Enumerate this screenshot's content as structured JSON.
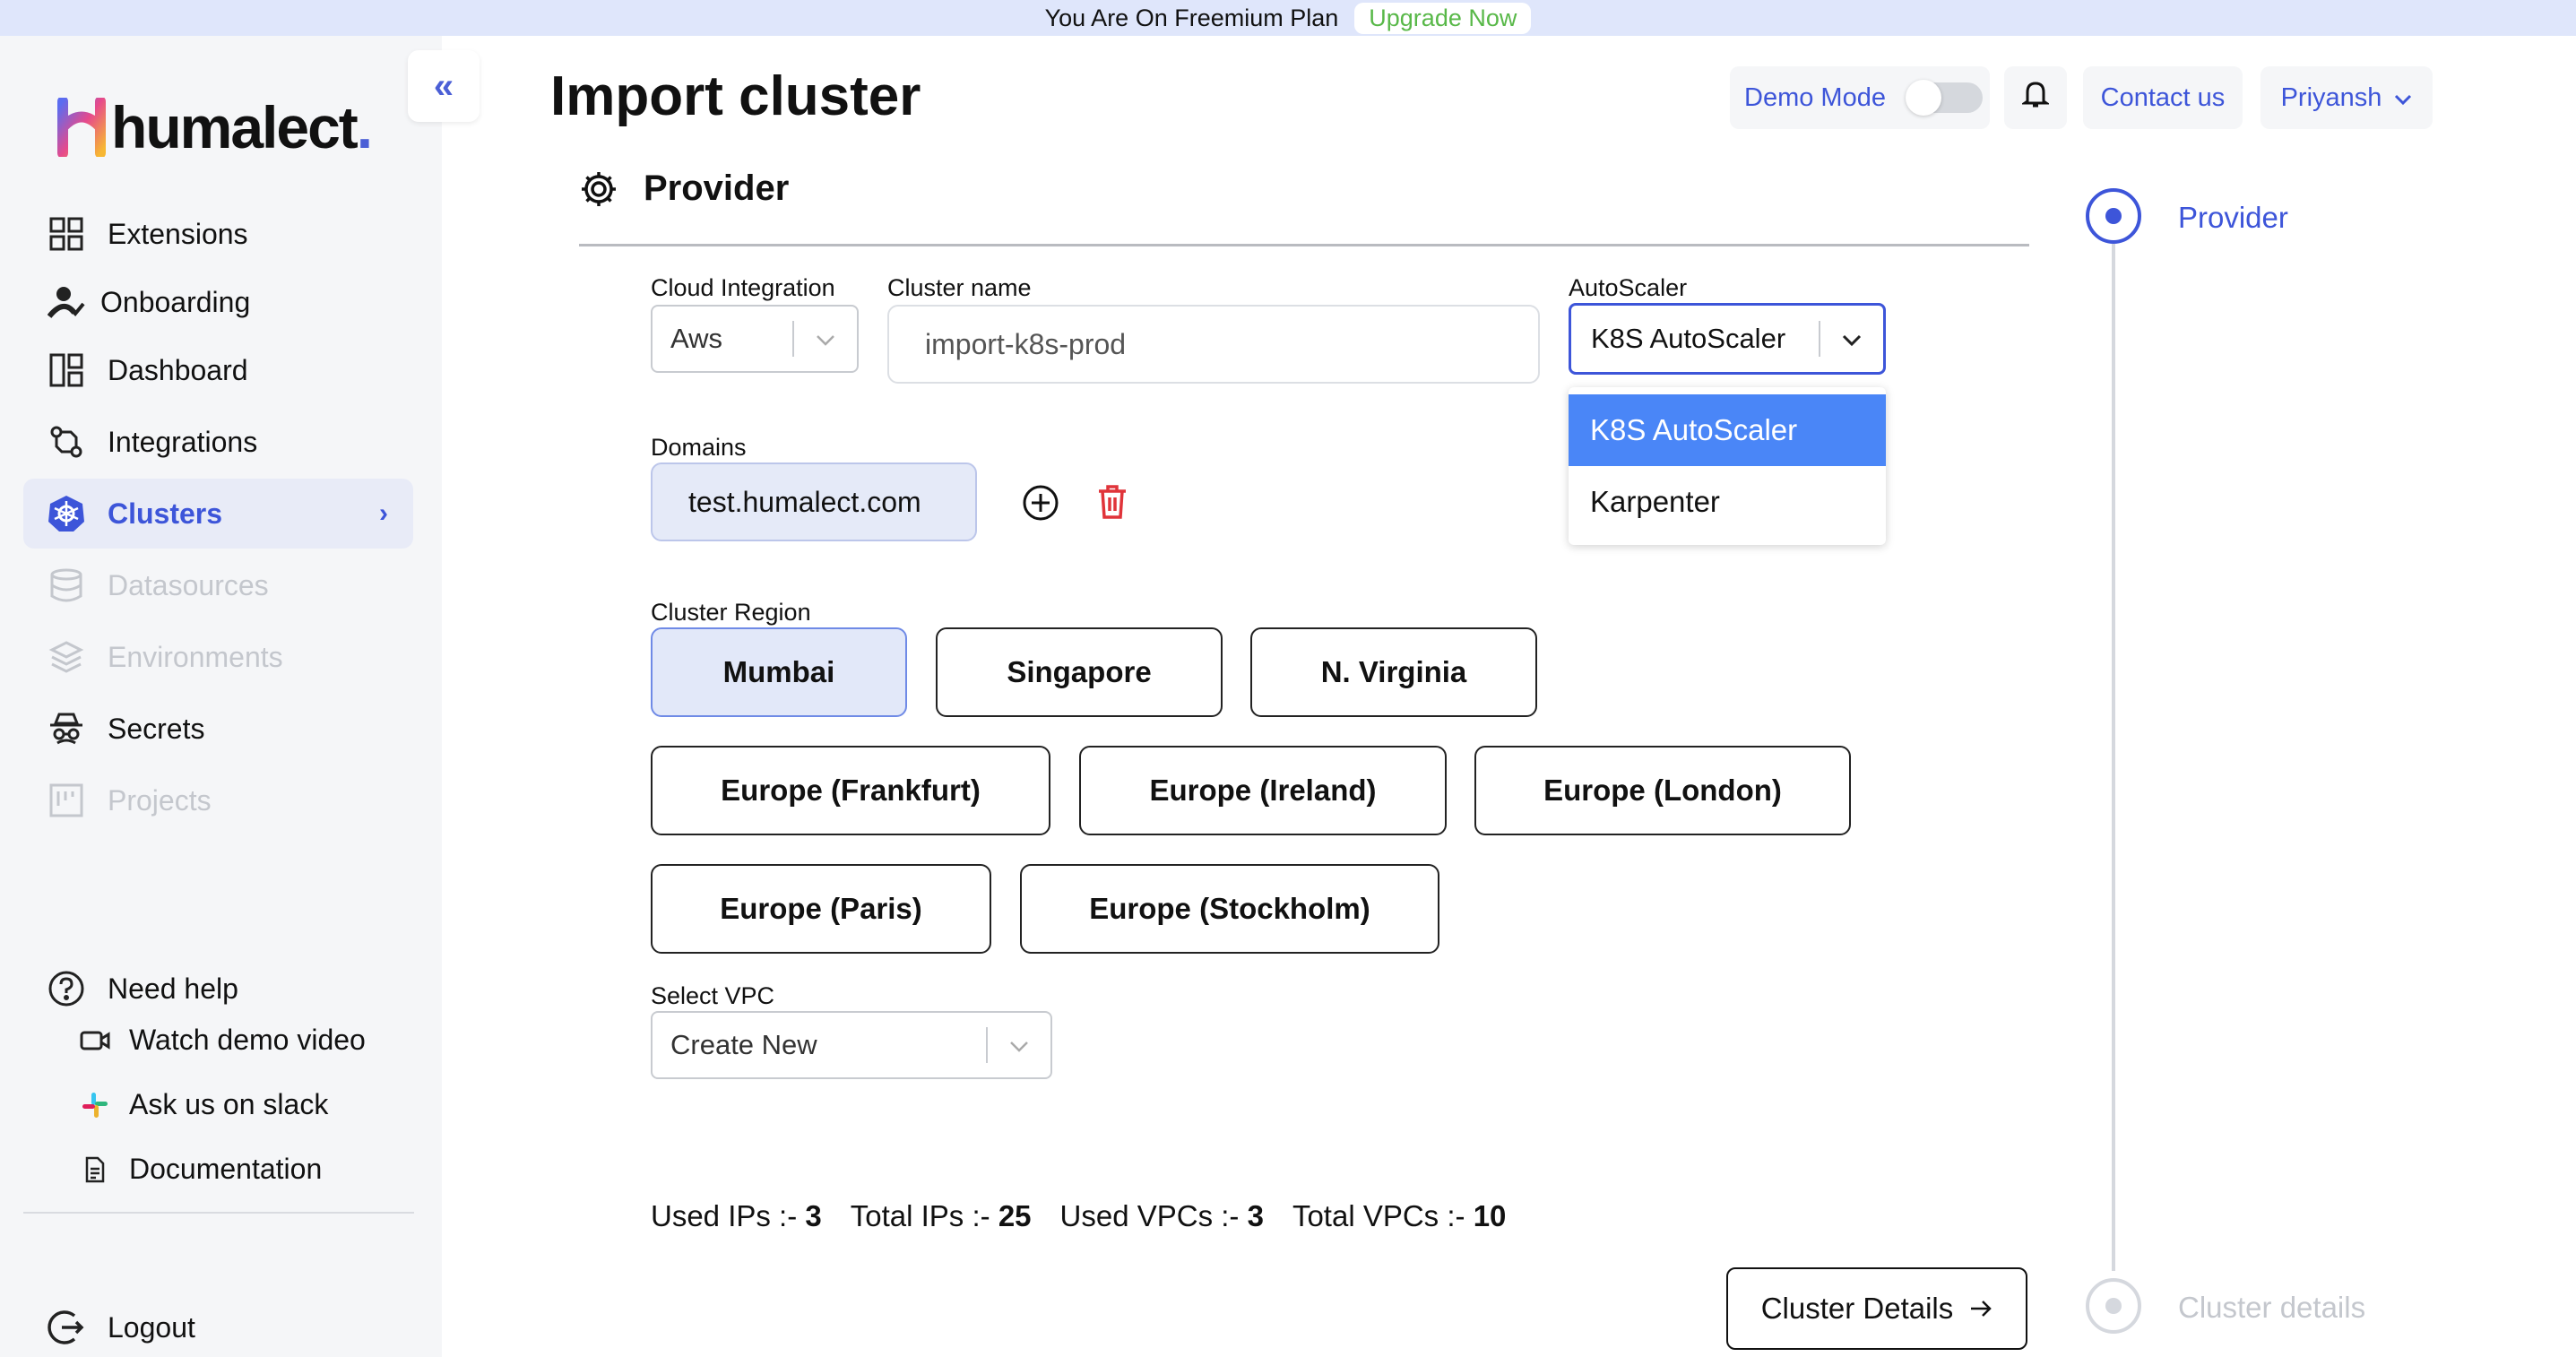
{
  "banner": {
    "text": "You Are On Freemium Plan",
    "upgrade": "Upgrade Now"
  },
  "brand": {
    "name": "humalect",
    "dot": "."
  },
  "sidebar": {
    "items": [
      {
        "label": "Extensions",
        "icon": "grid-icon",
        "state": "normal"
      },
      {
        "label": "Onboarding",
        "icon": "user-check-icon",
        "state": "normal"
      },
      {
        "label": "Dashboard",
        "icon": "layout-icon",
        "state": "normal"
      },
      {
        "label": "Integrations",
        "icon": "integrations-icon",
        "state": "normal"
      },
      {
        "label": "Clusters",
        "icon": "kubernetes-icon",
        "state": "active"
      },
      {
        "label": "Datasources",
        "icon": "database-icon",
        "state": "disabled"
      },
      {
        "label": "Environments",
        "icon": "layers-icon",
        "state": "disabled"
      },
      {
        "label": "Secrets",
        "icon": "spy-icon",
        "state": "normal"
      },
      {
        "label": "Projects",
        "icon": "board-icon",
        "state": "disabled"
      }
    ],
    "help": {
      "title": "Need help",
      "links": [
        "Watch demo video",
        "Ask us on slack",
        "Documentation"
      ]
    },
    "logout": "Logout"
  },
  "header": {
    "title": "Import cluster",
    "demo_mode": "Demo Mode",
    "contact": "Contact us",
    "user": "Priyansh"
  },
  "form": {
    "section": "Provider",
    "cloud_integration": {
      "label": "Cloud Integration",
      "value": "Aws"
    },
    "cluster_name": {
      "label": "Cluster name",
      "value": "import-k8s-prod"
    },
    "autoscaler": {
      "label": "AutoScaler",
      "value": "K8S AutoScaler",
      "options": [
        "K8S AutoScaler",
        "Karpenter"
      ]
    },
    "domains": {
      "label": "Domains",
      "value": "test.humalect.com"
    },
    "region": {
      "label": "Cluster Region",
      "options": [
        "Mumbai",
        "Singapore",
        "N. Virginia",
        "Europe (Frankfurt)",
        "Europe (Ireland)",
        "Europe (London)",
        "Europe (Paris)",
        "Europe (Stockholm)"
      ],
      "selected": "Mumbai"
    },
    "vpc": {
      "label": "Select VPC",
      "value": "Create New"
    }
  },
  "stats": {
    "used_ips_label": "Used IPs :-",
    "used_ips": "3",
    "total_ips_label": "Total IPs :-",
    "total_ips": "25",
    "used_vpcs_label": "Used VPCs :-",
    "used_vpcs": "3",
    "total_vpcs_label": "Total VPCs :-",
    "total_vpcs": "10"
  },
  "next_button": "Cluster Details",
  "stepper": {
    "steps": [
      "Provider",
      "Cluster details"
    ],
    "active": 0
  },
  "colors": {
    "accent": "#3d55d9",
    "highlight": "#4a86f7",
    "upgrade": "#58b848",
    "delete": "#e0343a"
  }
}
